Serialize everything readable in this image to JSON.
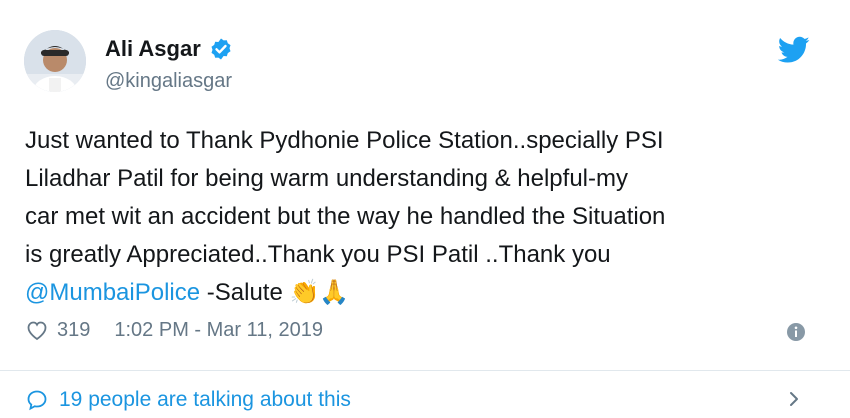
{
  "author": {
    "name": "Ali Asgar",
    "handle": "@kingaliasgar"
  },
  "tweet": {
    "text_part1": "Just wanted to Thank Pydhonie Police Station..specially PSI\nLiladhar Patil for being warm understanding & helpful-my\ncar met wit an accident but the way he handled the Situation\nis greatly Appreciated..Thank you PSI Patil ..Thank you\n",
    "mention": "@MumbaiPolice",
    "text_part2": " -Salute ",
    "emojis": "👏🙏"
  },
  "meta": {
    "likes": "319",
    "timestamp": "1:02 PM - Mar 11, 2019"
  },
  "footer": {
    "talking": "19 people are talking about this"
  },
  "colors": {
    "accent": "#1b95e0",
    "secondary_text": "#657786",
    "verified": "#1da1f2",
    "divider": "#e1e8ed"
  },
  "icons": [
    "verified-icon",
    "twitter-bird-icon",
    "heart-icon",
    "info-icon",
    "comment-bubble-icon",
    "chevron-right-icon"
  ]
}
